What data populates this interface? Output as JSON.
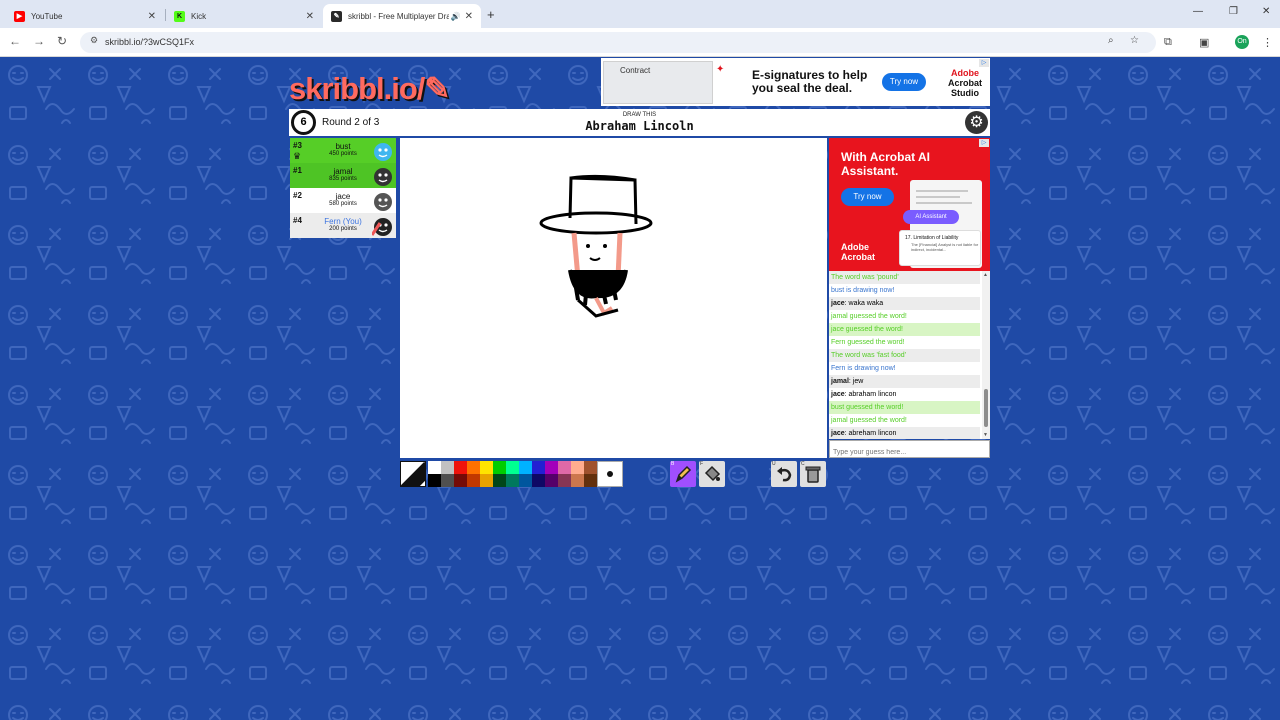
{
  "browser": {
    "tabs": [
      {
        "title": "YouTube",
        "favicon_color": "#ff0000",
        "favicon_glyph": "▶"
      },
      {
        "title": "Kick",
        "favicon_color": "#53fc18",
        "favicon_glyph": "K"
      },
      {
        "title": "skribbl - Free Multiplayer Drawing",
        "favicon_color": "#2a2a2a",
        "favicon_glyph": "✎"
      }
    ],
    "url": "skribbl.io/?3wCSQ1Fx",
    "profile_initials": "On"
  },
  "game": {
    "logo_text": "skribbl.io/",
    "timer": "6",
    "round_text": "Round 2 of 3",
    "draw_label": "DRAW THIS",
    "word": "Abraham Lincoln",
    "players": [
      {
        "rank": "#3",
        "name": "bust",
        "points": "450 points",
        "color": "#56ce27",
        "avatar_color": "#3fb6ef",
        "crown": true
      },
      {
        "rank": "#1",
        "name": "jamal",
        "points": "835 points",
        "color": "#4ec425",
        "avatar_color": "#333333",
        "crown": false
      },
      {
        "rank": "#2",
        "name": "jace",
        "points": "580 points",
        "color": "#ffffff",
        "avatar_color": "#555555",
        "crown": false
      },
      {
        "rank": "#4",
        "name": "Fern (You)",
        "points": "200 points",
        "color": "#ececec",
        "avatar_color": "#222222",
        "crown": false,
        "you": true
      }
    ],
    "chat": [
      {
        "type": "reveal",
        "text": "The word was 'pound'"
      },
      {
        "type": "info",
        "text": "bust is drawing now!"
      },
      {
        "type": "user",
        "name": "jace",
        "text": "waka waka"
      },
      {
        "type": "guess",
        "text": "jamal guessed the word!"
      },
      {
        "type": "guess",
        "text": "jace guessed the word!"
      },
      {
        "type": "guess",
        "text": "Fern guessed the word!"
      },
      {
        "type": "reveal",
        "text": "The word was 'fast food'"
      },
      {
        "type": "info",
        "text": "Fern is drawing now!"
      },
      {
        "type": "user",
        "name": "jamal",
        "text": "jew"
      },
      {
        "type": "user",
        "name": "jace",
        "text": "abraham lincon"
      },
      {
        "type": "guess",
        "text": "bust guessed the word!"
      },
      {
        "type": "guess",
        "text": "jamal guessed the word!"
      },
      {
        "type": "user",
        "name": "jace",
        "text": "abreham lincon"
      }
    ],
    "guess_placeholder": "Type your guess here...",
    "palette_top": [
      "#ffffff",
      "#c1c1c1",
      "#ef130b",
      "#ff7100",
      "#ffe400",
      "#00cc00",
      "#00ff91",
      "#00b2ff",
      "#231fd3",
      "#a300ba",
      "#df69a7",
      "#ffac8e",
      "#a0522d"
    ],
    "palette_bottom": [
      "#000000",
      "#505050",
      "#740b07",
      "#c23800",
      "#e8a200",
      "#004619",
      "#00785d",
      "#00569e",
      "#0e0865",
      "#550069",
      "#873554",
      "#cc774d",
      "#63300d"
    ],
    "tool_keys": {
      "pen": "B",
      "fill": "F",
      "undo": "U",
      "clear": "C"
    },
    "tool_color": "#a04fff"
  },
  "ads": {
    "top": {
      "image_tag": "Contract",
      "headline": "E-signatures to help you seal the deal.",
      "button": "Try now",
      "brand_line1": "Adobe",
      "brand_line2": "Acrobat",
      "brand_line3": "Studio"
    },
    "side": {
      "headline": "With Acrobat AI Assistant.",
      "button": "Try now",
      "pill": "AI Assistant",
      "card_title": "17. Limitation of Liability",
      "card_text": "The [Financial] Analyst is not liable for indirect, incidental...",
      "brand_line1": "Adobe",
      "brand_line2": "Acrobat"
    }
  }
}
